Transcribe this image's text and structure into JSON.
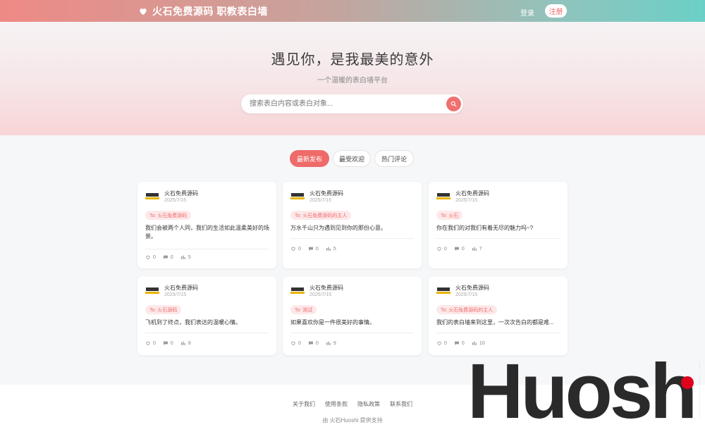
{
  "header": {
    "brand": "火石免费源码 职教表白墙",
    "login": "登录",
    "register": "注册"
  },
  "hero": {
    "title": "遇见你，是我最美的意外",
    "subtitle": "一个温暖的表白墙平台",
    "search_placeholder": "搜索表白内容或表白对象..."
  },
  "tabs": [
    {
      "label": "最新发布",
      "active": true
    },
    {
      "label": "最受欢迎",
      "active": false
    },
    {
      "label": "热门评论",
      "active": false
    }
  ],
  "posts": [
    {
      "author": "火石免费源码",
      "date": "2025/7/15",
      "tag": "To: 火石免费源码",
      "content": "我们会被两个人同，我们的生活如此温柔美好的场景。",
      "likes": "0",
      "comments": "0",
      "views": "5"
    },
    {
      "author": "火石免费源码",
      "date": "2025/7/15",
      "tag": "To: 火石免费源码的主人",
      "content": "万水千山只为遇到见到你的那份心意。",
      "likes": "0",
      "comments": "0",
      "views": "5"
    },
    {
      "author": "火石免费源码",
      "date": "2025/7/15",
      "tag": "To: 火石",
      "content": "你在我们的对我们有着无尽的魅力吗~?",
      "likes": "0",
      "comments": "0",
      "views": "7"
    },
    {
      "author": "火石免费源码",
      "date": "2025/7/15",
      "tag": "To: 火石源码",
      "content": "飞机到了终点，我们表达的温暖心情。",
      "likes": "0",
      "comments": "0",
      "views": "8"
    },
    {
      "author": "火石免费源码",
      "date": "2025/7/15",
      "tag": "To: 测试",
      "content": "如果喜欢你是一件很美好的事情。",
      "likes": "0",
      "comments": "0",
      "views": "9"
    },
    {
      "author": "火石免费源码",
      "date": "2025/7/15",
      "tag": "To: 火石免费源码的主人",
      "content": "我们的表白墙来到这里，一次次告白的都是难...",
      "likes": "0",
      "comments": "0",
      "views": "10"
    }
  ],
  "footer": {
    "links": [
      "关于我们",
      "使用条款",
      "隐私政策",
      "联系我们"
    ],
    "copyright": "由 火石Huoshi 提供支持"
  },
  "watermark": {
    "text": "Huoshi"
  },
  "colors": {
    "accent": "#ee6b69",
    "brand_red": "#e0001b",
    "tag_bg": "#fde9ea"
  },
  "icons": {
    "brand": "heart-icon",
    "search": "search-icon",
    "like": "heart-outline-icon",
    "comment": "comment-icon",
    "view": "view-icon"
  }
}
